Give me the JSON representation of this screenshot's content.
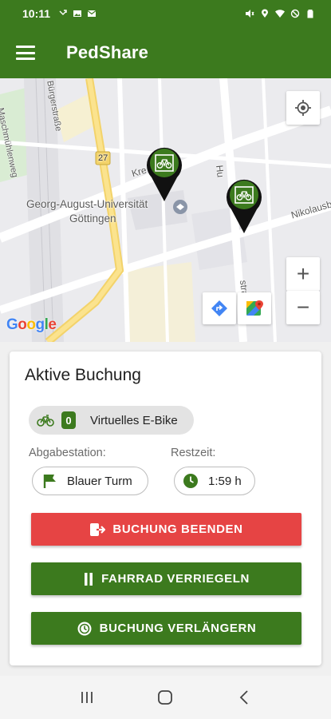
{
  "status_bar": {
    "time": "10:11",
    "left_icons": [
      "call-forward-icon",
      "image-icon",
      "mail-icon"
    ],
    "right_icons": [
      "mute-icon",
      "location-icon",
      "wifi-icon",
      "dnd-icon",
      "battery-icon"
    ]
  },
  "app_bar": {
    "title": "PedShare",
    "menu_icon": "hamburger-menu-icon"
  },
  "map": {
    "labels": {
      "university": "Georg-August-Universität",
      "city": "Göttingen",
      "road_number": "27",
      "street_nikolausberg": "Nikolausber",
      "street_krz": "Kre",
      "street_vertical": "Hu",
      "street_strasse": "straße",
      "street_left": "Maschmühlenweg",
      "street_top": "Bürgerstraße"
    },
    "controls": {
      "zoom_in": "+",
      "zoom_out": "−"
    },
    "logo_letters": [
      "G",
      "o",
      "o",
      "g",
      "l",
      "e"
    ],
    "colors": {
      "marker_green": "#3c7a1e",
      "marker_black": "#111111"
    }
  },
  "booking": {
    "title": "Aktive Buchung",
    "bike_count": "0",
    "bike_label": "Virtuelles E-Bike",
    "return_station_label": "Abgabestation:",
    "return_station_value": "Blauer Turm",
    "remaining_time_label": "Restzeit:",
    "remaining_time_value": "1:59 h",
    "buttons": {
      "end": "BUCHUNG BEENDEN",
      "lock": "FAHRRAD VERRIEGELN",
      "extend": "BUCHUNG VERLÄNGERN"
    },
    "colors": {
      "primary": "#3c7a1e",
      "danger": "#e64444"
    }
  },
  "nav_bar": {
    "icons": [
      "recent-apps-icon",
      "home-icon",
      "back-icon"
    ]
  }
}
